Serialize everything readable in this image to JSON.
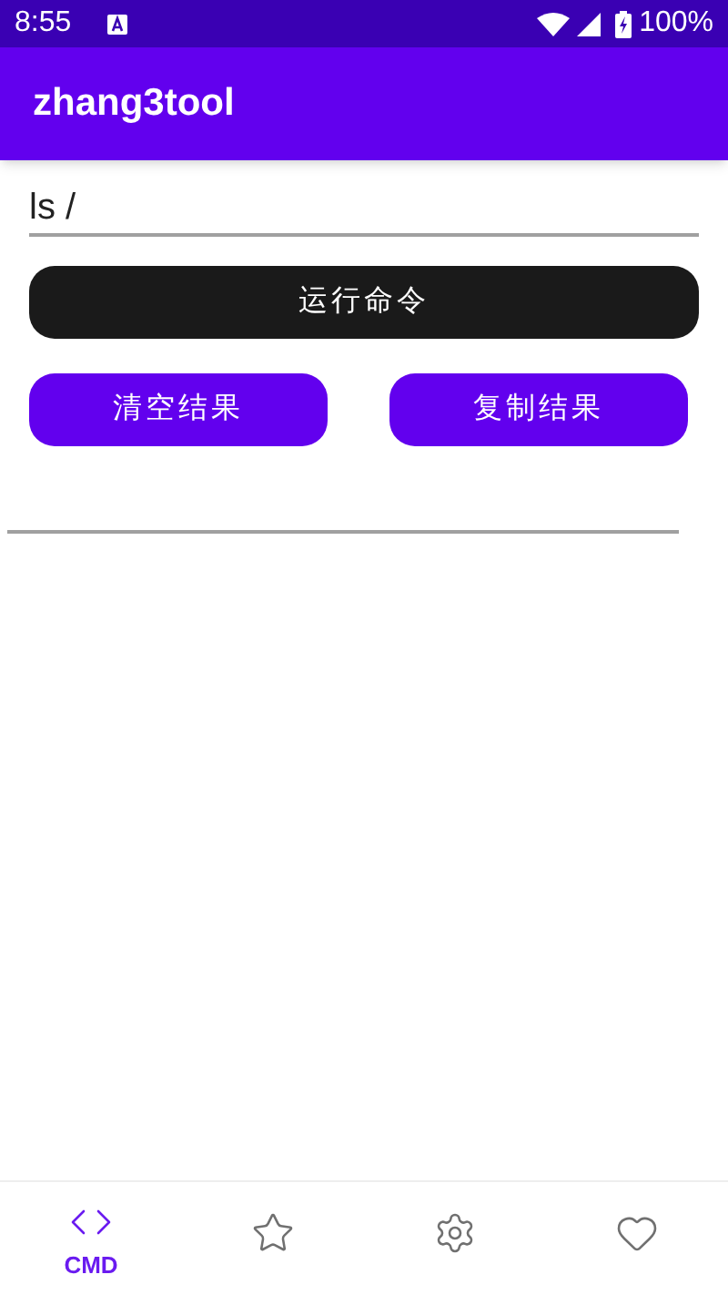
{
  "status_bar": {
    "time": "8:55",
    "battery": "100%"
  },
  "app_bar": {
    "title": "zhang3tool"
  },
  "command_field": {
    "value": "ls /"
  },
  "run_button": "运行命令",
  "action_buttons": [
    "清空结果",
    "复制结果"
  ],
  "bottom_nav": [
    {
      "kind": "code",
      "label": "CMD",
      "selected": true
    },
    {
      "kind": "star",
      "selected": false
    },
    {
      "kind": "settings",
      "selected": false
    },
    {
      "kind": "heart",
      "selected": false
    }
  ]
}
